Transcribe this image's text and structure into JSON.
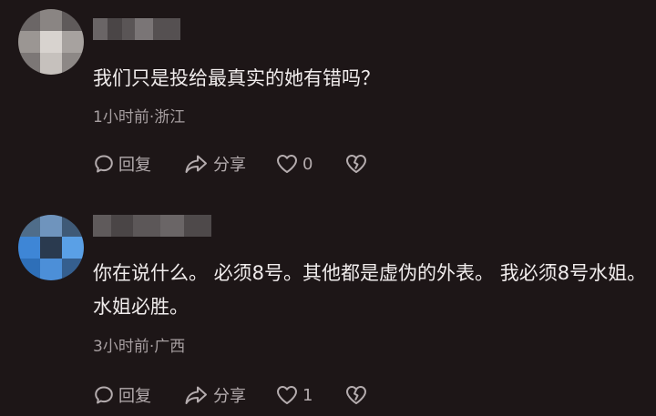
{
  "comments": [
    {
      "text": "我们只是投给最真实的她有错吗？",
      "meta": "1小时前·浙江",
      "actions": {
        "reply": "回复",
        "share": "分享",
        "likes": "0"
      }
    },
    {
      "text": "你在说什么。 必须8号。其他都是虚伪的外表。 我必须8号水姐。水姐必胜。",
      "meta": "3小时前·广西",
      "actions": {
        "reply": "回复",
        "share": "分享",
        "likes": "1"
      }
    }
  ],
  "icons": {
    "reply": "reply-bubble-icon",
    "share": "share-arrow-icon",
    "like": "heart-icon",
    "dislike": "broken-heart-icon"
  },
  "colors": {
    "background": "#1d1617",
    "text": "#f0ecec",
    "meta": "#a79fa1",
    "action": "#b4acae"
  }
}
